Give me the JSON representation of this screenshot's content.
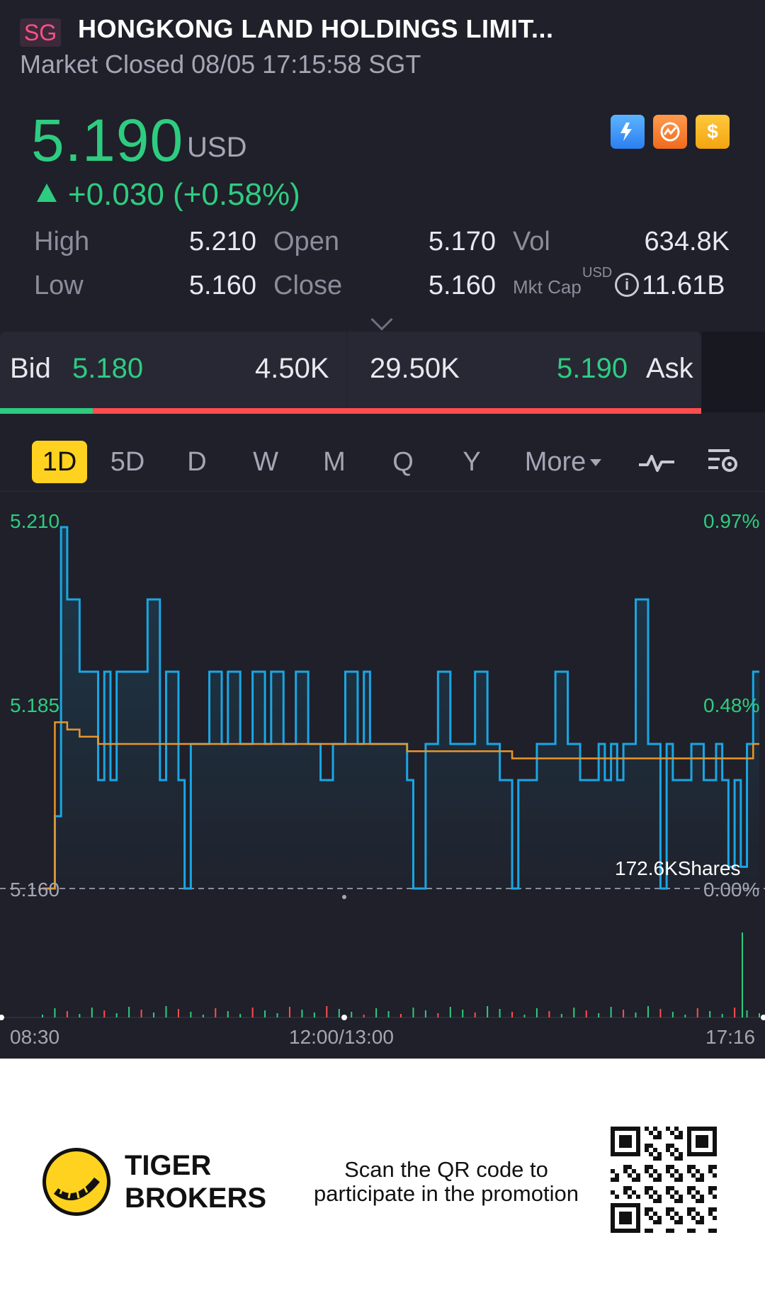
{
  "header": {
    "market_badge": "SG",
    "title": "HONGKONG LAND HOLDINGS LIMIT...",
    "status": "Market Closed 08/05 17:15:58 SGT"
  },
  "quote": {
    "price": "5.190",
    "currency": "USD",
    "change": "+0.030 (+0.58%)",
    "badges": [
      "lightning-icon",
      "crowd-icon",
      "dollar-icon"
    ],
    "colors": {
      "up": "#2ecc80",
      "down": "#ff4d4f",
      "accent": "#ffd21f"
    }
  },
  "stats": {
    "high_label": "High",
    "high": "5.210",
    "low_label": "Low",
    "low": "5.160",
    "open_label": "Open",
    "open": "5.170",
    "close_label": "Close",
    "close": "5.160",
    "vol_label": "Vol",
    "vol": "634.8K",
    "mktcap_label": "Mkt Cap",
    "mktcap_currency": "USD",
    "mktcap": "11.61B"
  },
  "bidask": {
    "bid_label": "Bid",
    "bid_price": "5.180",
    "bid_size": "4.50K",
    "ask_size": "29.50K",
    "ask_price": "5.190",
    "ask_label": "Ask",
    "bid_fraction": 0.132
  },
  "periods": {
    "tabs": [
      "1D",
      "5D",
      "D",
      "W",
      "M",
      "Q",
      "Y"
    ],
    "active": "1D",
    "more_label": "More"
  },
  "chart": {
    "left_axis": [
      "5.210",
      "5.185",
      "5.160"
    ],
    "right_axis": [
      "0.97%",
      "0.48%",
      "0.00%"
    ],
    "volume_label": "172.6KShares",
    "time_labels": [
      "08:30",
      "12:00/13:00",
      "17:16"
    ]
  },
  "chart_data": {
    "type": "line",
    "ylim": [
      5.16,
      5.21
    ],
    "baseline": 5.16,
    "x_labels": [
      "08:30",
      "12:00/13:00",
      "17:16"
    ],
    "series": [
      {
        "values": [
          5.16,
          5.16,
          5.17,
          5.21,
          5.2,
          5.2,
          5.19,
          5.19,
          5.19,
          5.175,
          5.19,
          5.175,
          5.19,
          5.19,
          5.19,
          5.19,
          5.19,
          5.2,
          5.2,
          5.175,
          5.19,
          5.19,
          5.175,
          5.16,
          5.18,
          5.18,
          5.18,
          5.19,
          5.19,
          5.18,
          5.19,
          5.19,
          5.18,
          5.18,
          5.19,
          5.19,
          5.18,
          5.19,
          5.19,
          5.18,
          5.18,
          5.19,
          5.19,
          5.18,
          5.18,
          5.175,
          5.175,
          5.18,
          5.18,
          5.19,
          5.19,
          5.18,
          5.19,
          5.18,
          5.18,
          5.18,
          5.18,
          5.18,
          5.18,
          5.175,
          5.16,
          5.16,
          5.18,
          5.18,
          5.19,
          5.19,
          5.18,
          5.18,
          5.18,
          5.18,
          5.19,
          5.19,
          5.18,
          5.18,
          5.175,
          5.175,
          5.16,
          5.175,
          5.175,
          5.175,
          5.18,
          5.18,
          5.18,
          5.19,
          5.19,
          5.18,
          5.18,
          5.175,
          5.175,
          5.175,
          5.18,
          5.175,
          5.18,
          5.175,
          5.18,
          5.18,
          5.2,
          5.2,
          5.18,
          5.18,
          5.16,
          5.18,
          5.175,
          5.175,
          5.175,
          5.18,
          5.18,
          5.175,
          5.175,
          5.18,
          5.175,
          5.163,
          5.175,
          5.163,
          5.18,
          5.19,
          5.19
        ]
      },
      {
        "values": [
          5.16,
          5.16,
          5.183,
          5.183,
          5.182,
          5.182,
          5.181,
          5.181,
          5.181,
          5.18,
          5.18,
          5.18,
          5.18,
          5.18,
          5.18,
          5.18,
          5.18,
          5.18,
          5.18,
          5.18,
          5.18,
          5.18,
          5.18,
          5.18,
          5.18,
          5.18,
          5.18,
          5.18,
          5.18,
          5.18,
          5.18,
          5.18,
          5.18,
          5.18,
          5.18,
          5.18,
          5.18,
          5.18,
          5.18,
          5.18,
          5.18,
          5.18,
          5.18,
          5.18,
          5.18,
          5.18,
          5.18,
          5.18,
          5.18,
          5.18,
          5.18,
          5.18,
          5.18,
          5.18,
          5.18,
          5.18,
          5.18,
          5.18,
          5.18,
          5.179,
          5.179,
          5.179,
          5.179,
          5.179,
          5.179,
          5.179,
          5.179,
          5.179,
          5.179,
          5.179,
          5.179,
          5.179,
          5.179,
          5.179,
          5.179,
          5.179,
          5.178,
          5.178,
          5.178,
          5.178,
          5.178,
          5.178,
          5.178,
          5.178,
          5.178,
          5.178,
          5.178,
          5.178,
          5.178,
          5.178,
          5.178,
          5.178,
          5.178,
          5.178,
          5.178,
          5.178,
          5.178,
          5.178,
          5.178,
          5.178,
          5.178,
          5.178,
          5.178,
          5.178,
          5.178,
          5.178,
          5.178,
          5.178,
          5.178,
          5.178,
          5.178,
          5.178,
          5.178,
          5.178,
          5.178,
          5.18,
          5.18
        ]
      }
    ],
    "colors": {
      "price": "#1aa6e4",
      "average": "#e8962a",
      "baseline": "#8a8d9b"
    }
  },
  "footer": {
    "brand_line1": "TIGER",
    "brand_line2": "BROKERS",
    "promo_line1": "Scan the QR code to",
    "promo_line2": "participate in the promotion"
  }
}
